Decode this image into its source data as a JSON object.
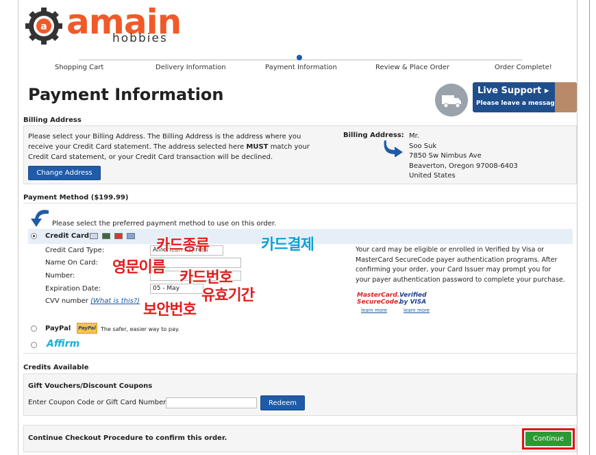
{
  "brand": {
    "name": "amain",
    "sub": "hobbies",
    "accent": "#f05a28"
  },
  "steps": [
    "Shopping Cart",
    "Delivery Information",
    "Payment Information",
    "Review & Place Order",
    "Order Complete!"
  ],
  "page_title": "Payment Information",
  "live_support": {
    "title": "Live Support ▸",
    "subtitle": "Please leave a message"
  },
  "billing": {
    "heading": "Billing Address",
    "text_1": "Please select your Billing Address. The Billing Address is the address where you",
    "text_2a": "receive your Credit Card statement. The address selected here ",
    "text_2b": "MUST",
    "text_2c": " match your",
    "text_3": "Credit Card statement, or your Credit Card transaction will be declined.",
    "change_button": "Change Address",
    "address_label": "Billing Address:",
    "address_lines": [
      "Mr.",
      "Soo Suk",
      "7850 Sw Nimbus Ave",
      "Beaverton, Oregon 97008-6403",
      "United States"
    ]
  },
  "payment": {
    "heading": "Payment Method ($199.99)",
    "prompt": "Please select the preferred payment method to use on this order.",
    "credit_card_label": "Credit Card",
    "fields": {
      "type_label": "Credit Card Type:",
      "type_value": "American Express",
      "name_label": "Name On Card:",
      "number_label": "Number:",
      "exp_label": "Expiration Date:",
      "exp_value": "05 - May",
      "cvv_label": "CVV number",
      "cvv_link": "(What is this?)"
    },
    "verify_text": [
      "Your card may be eligible or enrolled in Verified by Visa or",
      "MasterCard SecureCode payer authentication programs. After",
      "confirming your order, your Card Issuer may prompt you for",
      "your payer authentication password to complete your purchase."
    ],
    "mastercard_badge": "MasterCard. SecureCode.",
    "visa_badge": "Verified by VISA",
    "learn_more": "learn more",
    "paypal_label": "PayPal",
    "paypal_logo": "PayPal",
    "paypal_text": "The safer, easier way to pay.",
    "affirm_label": "Affirm"
  },
  "annotations": {
    "card_type": "카드종류",
    "card_payment": "카드결제",
    "english_name": "영문이름",
    "card_number": "카드번호",
    "expiry": "유효기간",
    "cvv": "보안번호"
  },
  "credits": {
    "heading": "Credits Available",
    "sub_heading": "Gift Vouchers/Discount Coupons",
    "coupon_label": "Enter Coupon Code or Gift Card Number",
    "coupon_value": "",
    "redeem_button": "Redeem"
  },
  "footer": {
    "text": "Continue Checkout Procedure to confirm this order.",
    "continue_button": "Continue"
  }
}
